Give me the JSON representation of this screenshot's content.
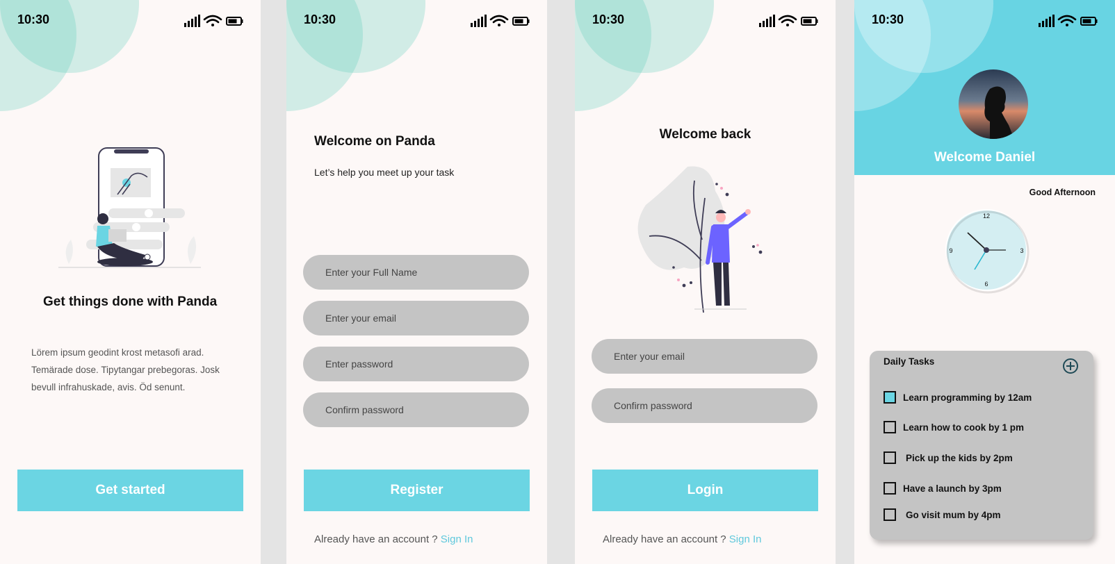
{
  "status_bar": {
    "time": "10:30"
  },
  "onboarding": {
    "title": "Get things done with Panda",
    "body": "Lörem ipsum geodint krost metasofi arad. Temärade dose. Tipytangar prebegoras. Josk bevull infrahuskade, avis. Öd senunt.",
    "button": "Get started"
  },
  "register": {
    "title": "Welcome on Panda",
    "subtitle": "Let’s help you meet up your task",
    "fields": [
      {
        "placeholder": "Enter your Full Name"
      },
      {
        "placeholder": "Enter your email"
      },
      {
        "placeholder": "Enter password"
      },
      {
        "placeholder": "Confirm password"
      }
    ],
    "button": "Register",
    "footer_text": "Already have an account ? ",
    "footer_link": "Sign In"
  },
  "login": {
    "title": "Welcome back",
    "fields": [
      {
        "placeholder": "Enter your email"
      },
      {
        "placeholder": "Confirm password"
      }
    ],
    "button": "Login",
    "footer_text": "Already have an account ? ",
    "footer_link": "Sign In"
  },
  "dashboard": {
    "welcome": "Welcome Daniel",
    "greeting": "Good Afternoon",
    "clock": {
      "n12": "12",
      "n3": "3",
      "n6": "6",
      "n9": "9"
    },
    "tasks_title": "Daily Tasks",
    "tasks": [
      {
        "label": "Learn programming by 12am",
        "checked": true
      },
      {
        "label": "Learn how to cook by 1 pm",
        "checked": false
      },
      {
        "label": "Pick up the kids by 2pm",
        "checked": false
      },
      {
        "label": "Have a launch by 3pm",
        "checked": false
      },
      {
        "label": "Go visit mum by 4pm",
        "checked": false
      }
    ]
  },
  "colors": {
    "accent": "#6bd5e3",
    "field": "#c4c4c4",
    "link": "#5fc8dc",
    "background": "#fdf8f7"
  },
  "icons": [
    "signal-icon",
    "wifi-icon",
    "battery-icon",
    "add-task-icon"
  ]
}
